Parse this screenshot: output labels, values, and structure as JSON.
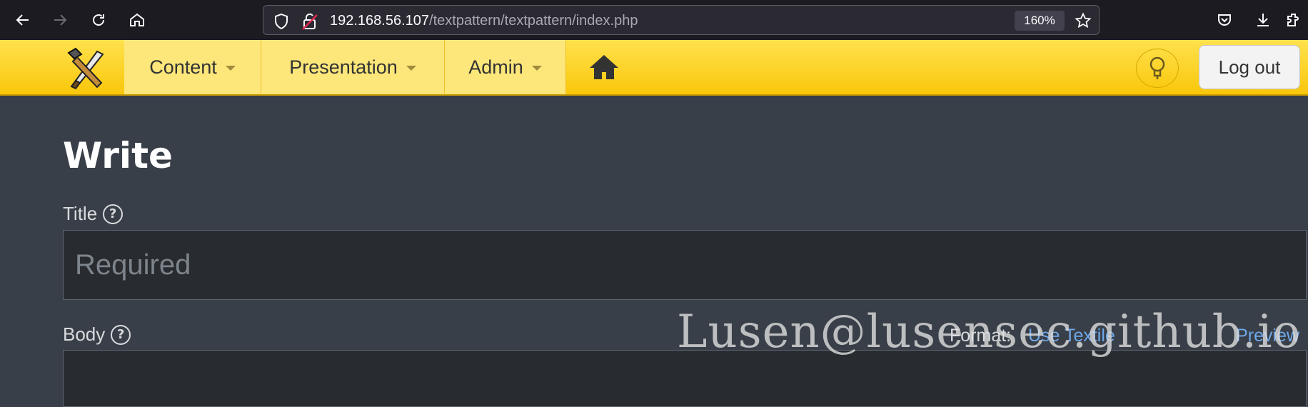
{
  "browser": {
    "url_host": "192.168.56.107",
    "url_path": "/textpattern/textpattern/index.php",
    "zoom": "160%",
    "icons": [
      "back-icon",
      "forward-icon",
      "reload-icon",
      "home-icon",
      "shield-icon",
      "insecure-lock-icon",
      "bookmark-star-icon",
      "pocket-icon",
      "downloads-icon",
      "extensions-icon"
    ]
  },
  "header": {
    "menu": [
      {
        "label": "Content"
      },
      {
        "label": "Presentation"
      },
      {
        "label": "Admin"
      }
    ],
    "logout_label": "Log out",
    "colors": {
      "bar": "#f9c70b",
      "menu_item": "#fde67a"
    }
  },
  "write": {
    "title": "Write",
    "title_label": "Title",
    "title_placeholder": "Required",
    "body_label": "Body",
    "help_glyph": "?",
    "format_label": "Format:",
    "format_link": "Use Textile",
    "preview_link": "Preview"
  },
  "watermark": "Lusen@lusensec.github.io",
  "colors": {
    "page_bg": "#393f48",
    "input_bg": "#282c31",
    "link": "#6ea9ea"
  }
}
